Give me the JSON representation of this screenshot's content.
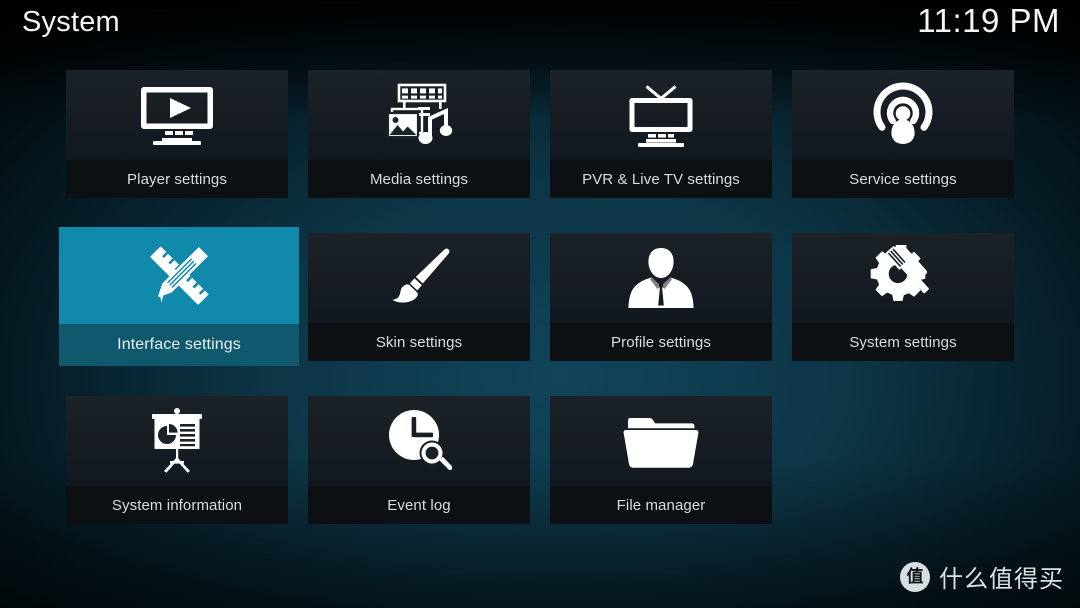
{
  "header": {
    "title": "System",
    "clock": "11:19 PM"
  },
  "theme": {
    "accent": "#1189ab",
    "accent_dark": "#10596d",
    "tile_icon_bg": "#1b2228",
    "tile_label_bg": "#0c1013",
    "text": "#d8dde2",
    "background": "#0d3546"
  },
  "grid": {
    "rows": [
      [
        {
          "label": "Player settings",
          "icon": "tv-play-icon",
          "selected": false
        },
        {
          "label": "Media settings",
          "icon": "media-filmstrip-icon",
          "selected": false
        },
        {
          "label": "PVR & Live TV settings",
          "icon": "tv-antenna-icon",
          "selected": false
        },
        {
          "label": "Service settings",
          "icon": "broadcast-person-icon",
          "selected": false
        }
      ],
      [
        {
          "label": "Interface settings",
          "icon": "ruler-pencil-icon",
          "selected": true
        },
        {
          "label": "Skin settings",
          "icon": "paintbrush-icon",
          "selected": false
        },
        {
          "label": "Profile settings",
          "icon": "person-bust-icon",
          "selected": false
        },
        {
          "label": "System settings",
          "icon": "gear-screwdriver-icon",
          "selected": false
        }
      ],
      [
        {
          "label": "System information",
          "icon": "presentation-chart-icon",
          "selected": false
        },
        {
          "label": "Event log",
          "icon": "clock-search-icon",
          "selected": false
        },
        {
          "label": "File manager",
          "icon": "folder-open-icon",
          "selected": false
        }
      ]
    ]
  },
  "watermark": {
    "badge": "值",
    "text": "什么值得买"
  }
}
